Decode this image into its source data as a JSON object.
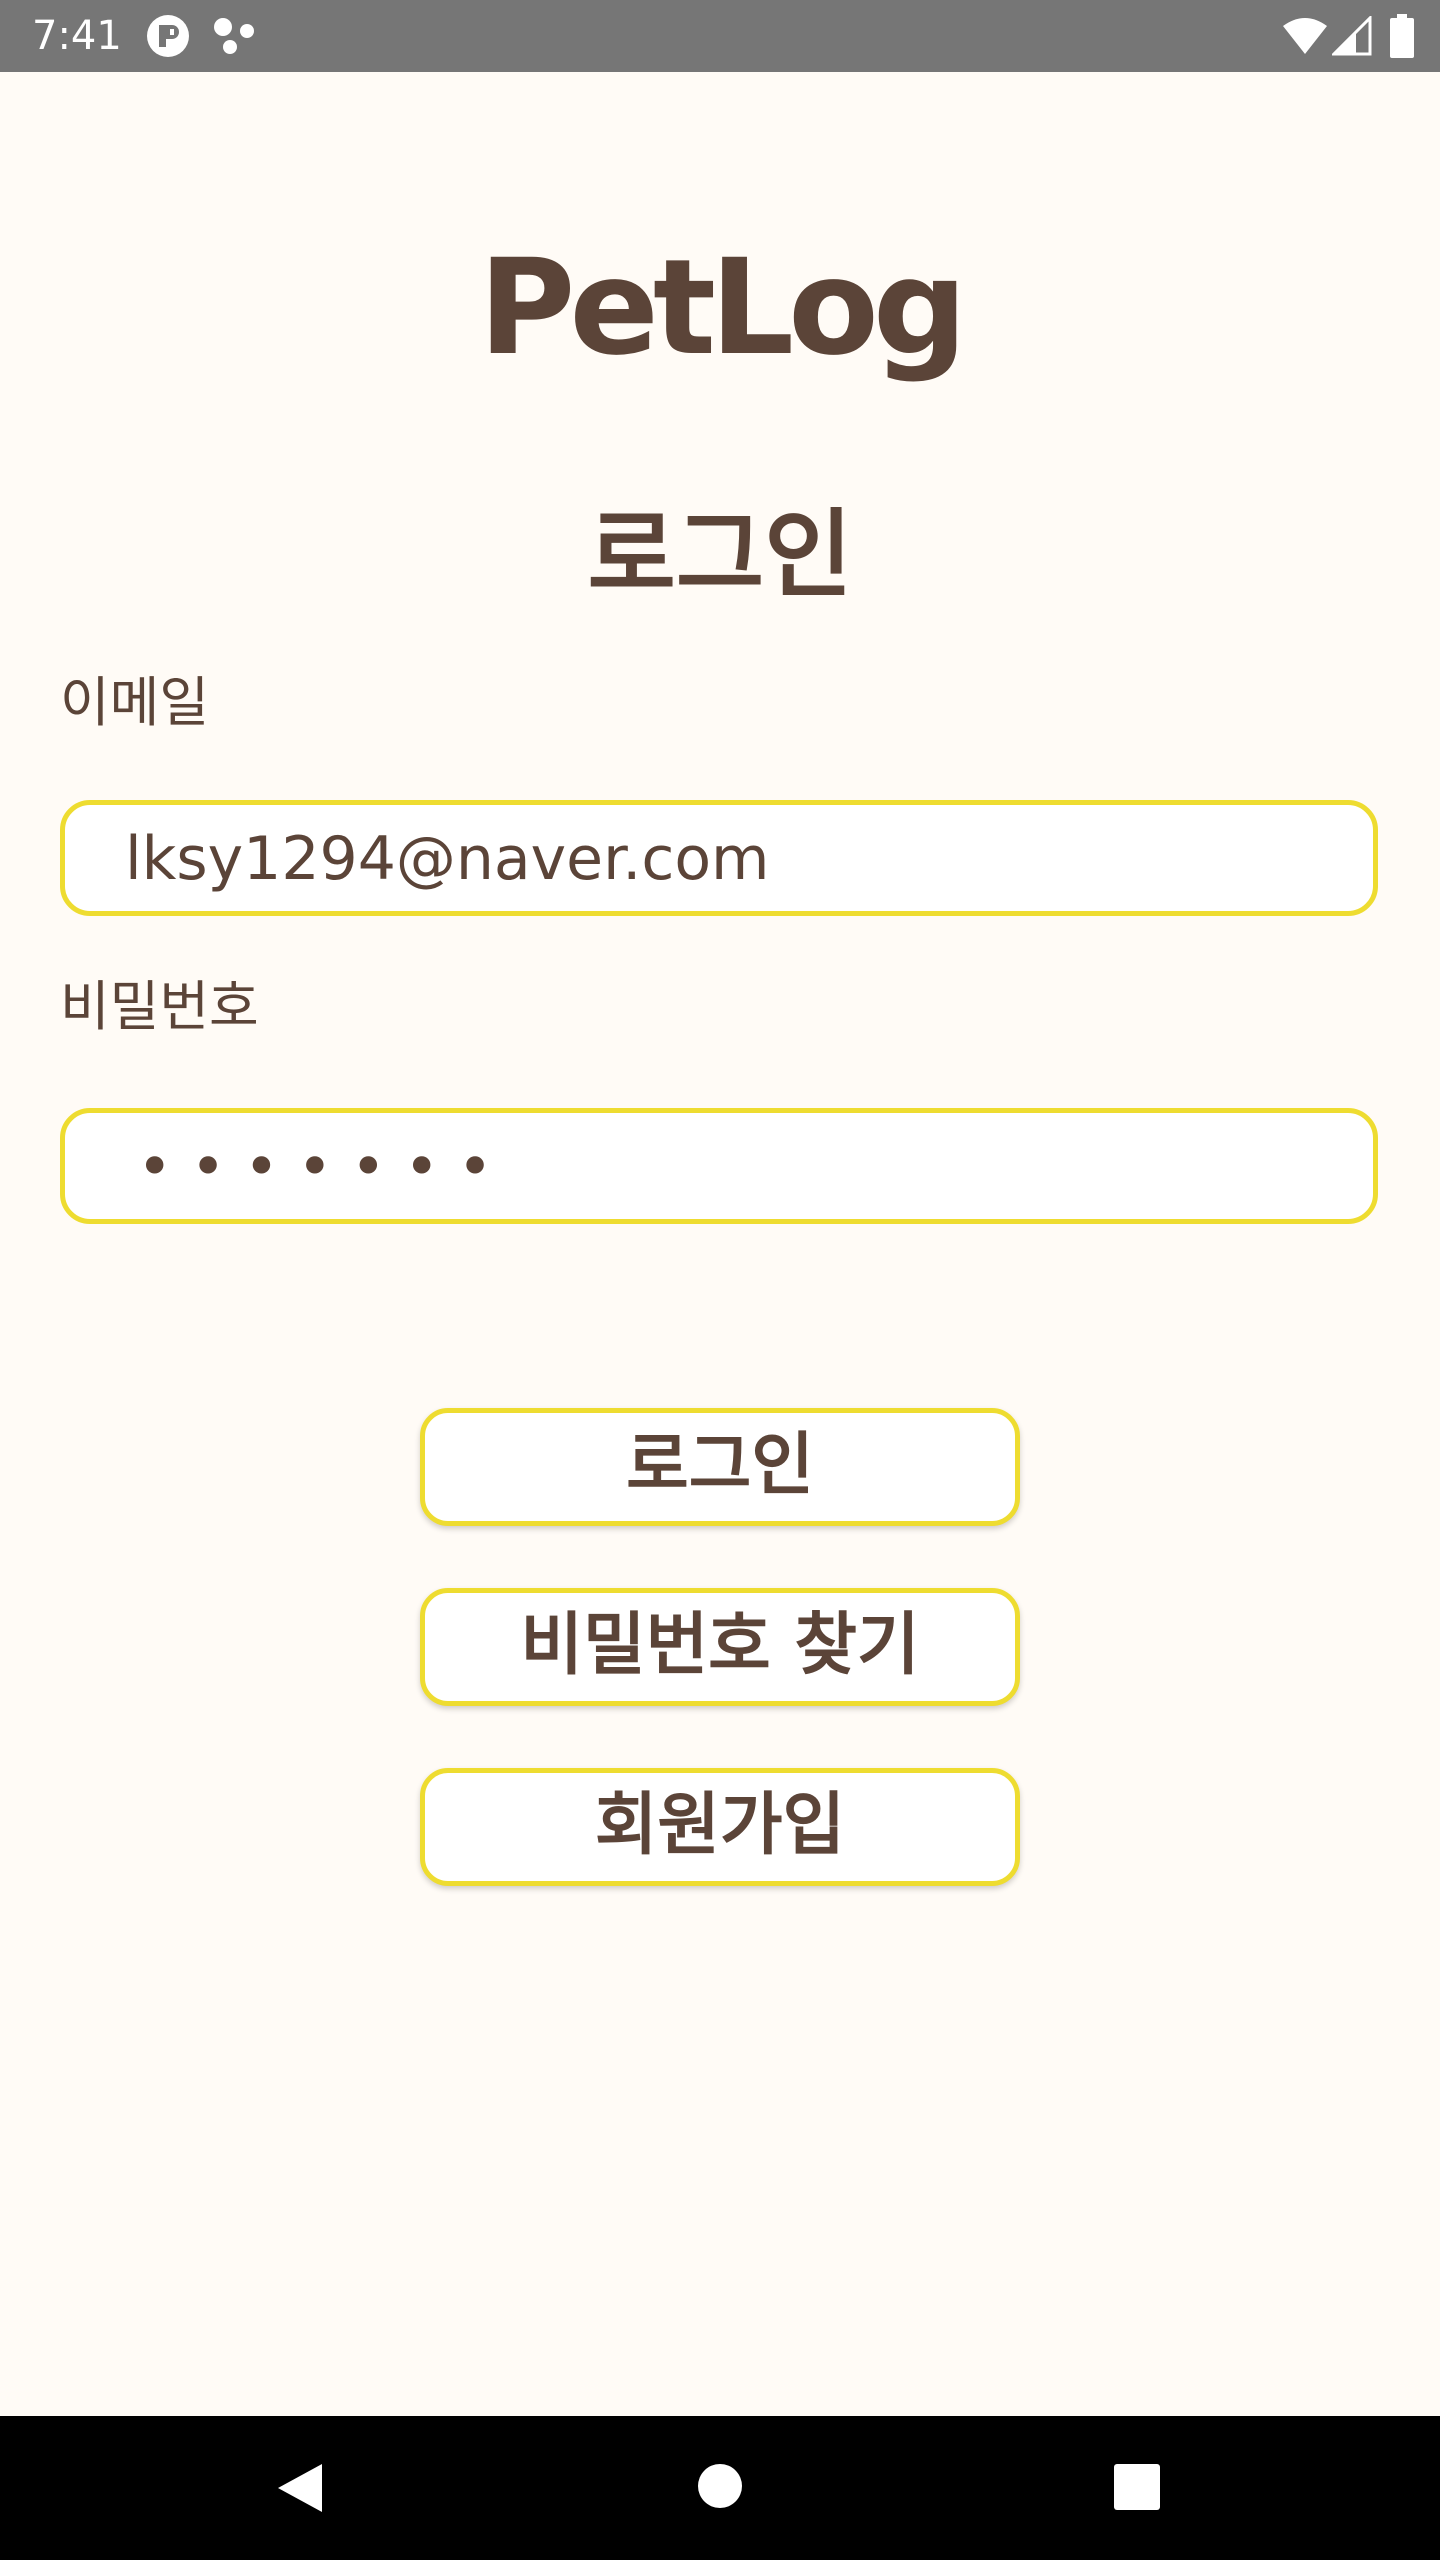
{
  "status_bar": {
    "time": "7:41",
    "left_icons": [
      "notification-app-icon",
      "dots-app-icon"
    ],
    "right_icons": [
      "wifi-icon",
      "cell-signal-icon",
      "battery-icon"
    ]
  },
  "app": {
    "title": "PetLog"
  },
  "login": {
    "heading": "로그인",
    "email_label": "이메일",
    "email_value": "lksy1294@naver.com",
    "password_label": "비밀번호",
    "password_mask": "•••••••"
  },
  "buttons": {
    "login": "로그인",
    "find_password": "비밀번호 찾기",
    "signup": "회원가입"
  },
  "nav_bar": {
    "icons": [
      "back-icon",
      "home-icon",
      "recents-icon"
    ]
  },
  "colors": {
    "background": "#FFFBF6",
    "text": "#5B4438",
    "accent_border": "#EEDC30",
    "status_bar": "#767676",
    "nav_bar": "#000000"
  }
}
